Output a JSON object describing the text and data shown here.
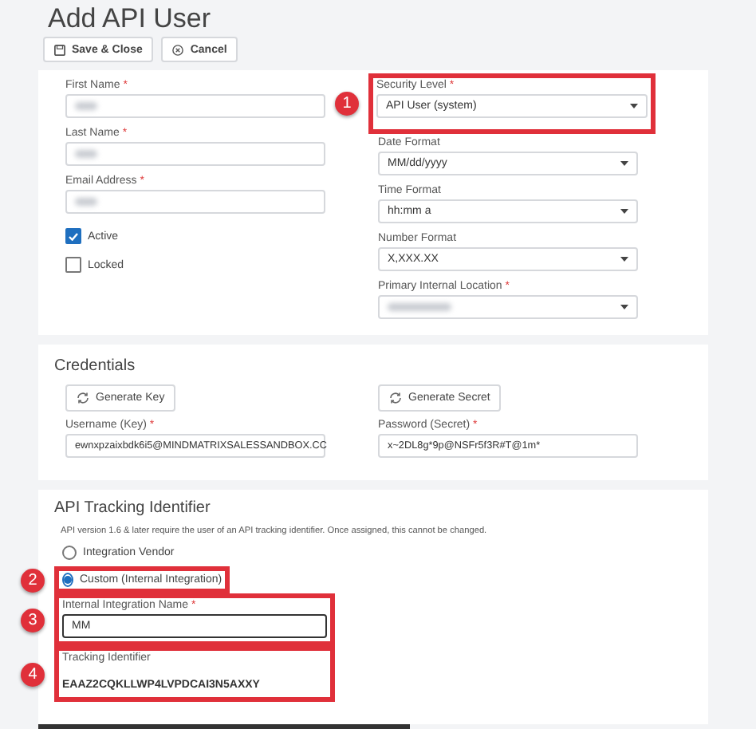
{
  "title": "Add API User",
  "toolbar": [
    {
      "kind": "save",
      "label": "Save & Close"
    },
    {
      "kind": "cancel",
      "label": "Cancel"
    }
  ],
  "general": {
    "left": [
      {
        "kind": "text",
        "label": "First Name",
        "asterisk": "*",
        "redacted": true
      },
      {
        "kind": "text",
        "label": "Last Name",
        "asterisk": "*",
        "redacted": true
      },
      {
        "kind": "text",
        "label": "Email Address",
        "asterisk": "*",
        "redacted": true
      },
      {
        "kind": "checkbox",
        "label": "Active",
        "checked": true
      },
      {
        "kind": "checkbox",
        "label": "Locked",
        "checked": false
      }
    ],
    "right": [
      {
        "kind": "select",
        "label": "Security Level",
        "asterisk": "*",
        "value": "API User (system)",
        "callout": "1"
      },
      {
        "kind": "select",
        "label": "Date Format",
        "value": "MM/dd/yyyy"
      },
      {
        "kind": "select",
        "label": "Time Format",
        "value": "hh:mm a"
      },
      {
        "kind": "select",
        "label": "Number Format",
        "value": "X,XXX.XX"
      },
      {
        "kind": "select",
        "label": "Primary Internal Location",
        "asterisk": "*",
        "redacted": true
      }
    ]
  },
  "credentials": {
    "title": "Credentials",
    "columns": [
      {
        "button": "Generate Key",
        "label": "Username (Key)",
        "asterisk": "*",
        "value": "ewnxpzaixbdk6i5@MINDMATRIXSALESSANDBOX.CC"
      },
      {
        "button": "Generate Secret",
        "label": "Password (Secret)",
        "asterisk": "*",
        "value": "x~2DL8g*9p@NSFr5f3R#T@1m*"
      }
    ]
  },
  "tracking": {
    "title": "API Tracking Identifier",
    "note": "API version 1.6 & later require the user of an API tracking identifier. Once assigned, this cannot be changed.",
    "options": [
      {
        "label": "Integration Vendor",
        "selected": false
      },
      {
        "label": "Custom (Internal Integration)",
        "selected": true,
        "callout": "2"
      }
    ],
    "name_field": {
      "label": "Internal Integration Name",
      "asterisk": "*",
      "value": "MM",
      "callout": "3"
    },
    "identifier": {
      "label": "Tracking Identifier",
      "value": "EAAZ2CQKLLWP4LVPDCAI3N5AXXY",
      "callout": "4"
    }
  }
}
